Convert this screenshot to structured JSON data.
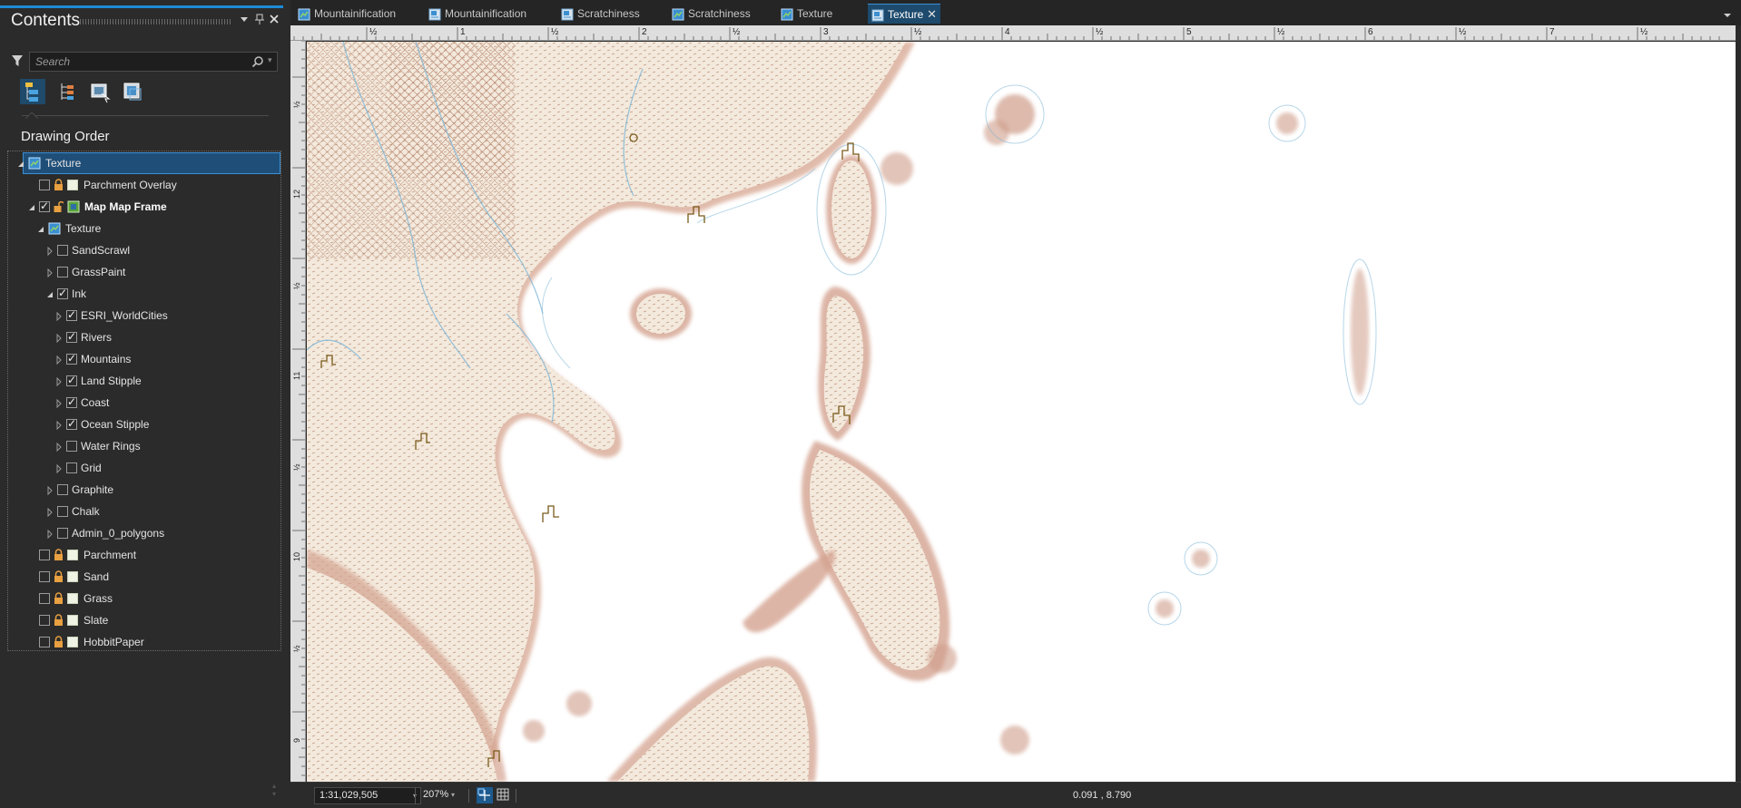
{
  "contents_pane": {
    "title": "Contents",
    "search_placeholder": "Search",
    "section_title": "Drawing Order",
    "tree": [
      {
        "label": "Texture",
        "depth": 0,
        "expander": "expanded",
        "checkbox": "none",
        "lock": false,
        "icon": "map-icon",
        "bold": false,
        "selected": true
      },
      {
        "label": "Parchment Overlay",
        "depth": 1,
        "expander": "none",
        "checkbox": "unchecked",
        "lock": true,
        "icon": "swatch",
        "bold": false
      },
      {
        "label": "Map Map Frame",
        "depth": 1,
        "expander": "expanded",
        "checkbox": "checked",
        "lock": "open",
        "icon": "map-frame-icon",
        "bold": true
      },
      {
        "label": "Texture",
        "depth": 2,
        "expander": "expanded",
        "checkbox": "none",
        "lock": false,
        "icon": "map-icon",
        "bold": false
      },
      {
        "label": "SandScrawl",
        "depth": 3,
        "expander": "collapsed",
        "checkbox": "unchecked",
        "lock": false,
        "icon": "none",
        "bold": false
      },
      {
        "label": "GrassPaint",
        "depth": 3,
        "expander": "collapsed",
        "checkbox": "unchecked",
        "lock": false,
        "icon": "none",
        "bold": false
      },
      {
        "label": "Ink",
        "depth": 3,
        "expander": "expanded",
        "checkbox": "checked",
        "lock": false,
        "icon": "none",
        "bold": false
      },
      {
        "label": "ESRI_WorldCities",
        "depth": 4,
        "expander": "collapsed",
        "checkbox": "checked",
        "lock": false,
        "icon": "none",
        "bold": false
      },
      {
        "label": "Rivers",
        "depth": 4,
        "expander": "collapsed",
        "checkbox": "checked",
        "lock": false,
        "icon": "none",
        "bold": false
      },
      {
        "label": "Mountains",
        "depth": 4,
        "expander": "collapsed",
        "checkbox": "checked",
        "lock": false,
        "icon": "none",
        "bold": false
      },
      {
        "label": "Land Stipple",
        "depth": 4,
        "expander": "collapsed",
        "checkbox": "checked",
        "lock": false,
        "icon": "none",
        "bold": false
      },
      {
        "label": "Coast",
        "depth": 4,
        "expander": "collapsed",
        "checkbox": "checked",
        "lock": false,
        "icon": "none",
        "bold": false
      },
      {
        "label": "Ocean Stipple",
        "depth": 4,
        "expander": "collapsed",
        "checkbox": "checked",
        "lock": false,
        "icon": "none",
        "bold": false
      },
      {
        "label": "Water Rings",
        "depth": 4,
        "expander": "collapsed",
        "checkbox": "unchecked",
        "lock": false,
        "icon": "none",
        "bold": false
      },
      {
        "label": "Grid",
        "depth": 4,
        "expander": "collapsed",
        "checkbox": "unchecked",
        "lock": false,
        "icon": "none",
        "bold": false
      },
      {
        "label": "Graphite",
        "depth": 3,
        "expander": "collapsed",
        "checkbox": "unchecked",
        "lock": false,
        "icon": "none",
        "bold": false
      },
      {
        "label": "Chalk",
        "depth": 3,
        "expander": "collapsed",
        "checkbox": "unchecked",
        "lock": false,
        "icon": "none",
        "bold": false
      },
      {
        "label": "Admin_0_polygons",
        "depth": 3,
        "expander": "collapsed",
        "checkbox": "unchecked",
        "lock": false,
        "icon": "none",
        "bold": false
      },
      {
        "label": "Parchment",
        "depth": 1,
        "expander": "none",
        "checkbox": "unchecked",
        "lock": true,
        "icon": "swatch",
        "bold": false
      },
      {
        "label": "Sand",
        "depth": 1,
        "expander": "none",
        "checkbox": "unchecked",
        "lock": true,
        "icon": "swatch",
        "bold": false
      },
      {
        "label": "Grass",
        "depth": 1,
        "expander": "none",
        "checkbox": "unchecked",
        "lock": true,
        "icon": "swatch",
        "bold": false
      },
      {
        "label": "Slate",
        "depth": 1,
        "expander": "none",
        "checkbox": "unchecked",
        "lock": true,
        "icon": "swatch",
        "bold": false
      },
      {
        "label": "HobbitPaper",
        "depth": 1,
        "expander": "none",
        "checkbox": "unchecked",
        "lock": true,
        "icon": "swatch",
        "bold": false
      }
    ]
  },
  "tabs": [
    {
      "label": "Mountainification",
      "icon": "map-icon",
      "active": false
    },
    {
      "label": "Mountainification",
      "icon": "layout-icon",
      "active": false
    },
    {
      "label": "Scratchiness",
      "icon": "layout-icon",
      "active": false
    },
    {
      "label": "Scratchiness",
      "icon": "map-icon",
      "active": false
    },
    {
      "label": "Texture",
      "icon": "map-icon",
      "active": false
    },
    {
      "label": "Texture",
      "icon": "layout-icon",
      "active": true
    }
  ],
  "ruler_top_labels": [
    "½",
    "1",
    "½",
    "2",
    "½",
    "3",
    "½",
    "4",
    "½",
    "5",
    "½",
    "6",
    "½",
    "7",
    "½"
  ],
  "ruler_left_labels": [
    "½",
    "12",
    "½",
    "11",
    "½",
    "10",
    "½",
    "9"
  ],
  "status_bar": {
    "scale": "1:31,029,505",
    "zoom": "207%",
    "coordinates": "0.091 , 8.790"
  },
  "colors": {
    "accent": "#1e8ad6",
    "land": "#c9957f",
    "water": "#6aa8cc",
    "ink": "#8a6a2a"
  }
}
